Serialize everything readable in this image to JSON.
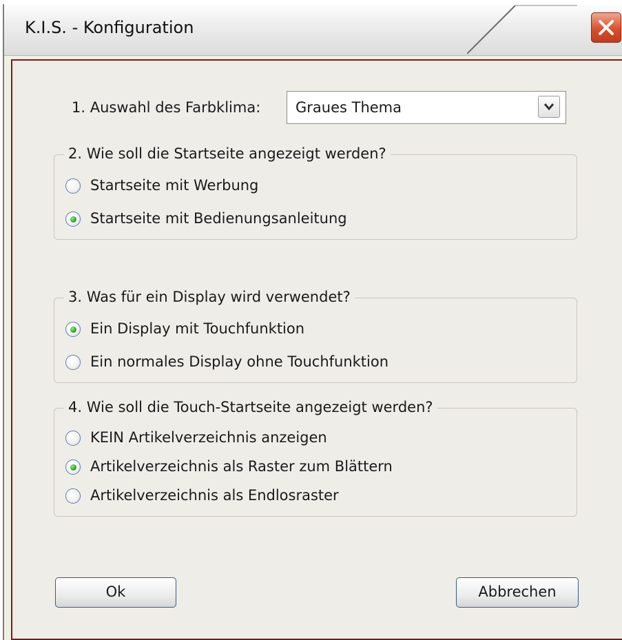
{
  "window": {
    "title": "K.I.S. - Konfiguration"
  },
  "theme": {
    "label": "1. Auswahl des Farbklima:",
    "selected": "Graues Thema"
  },
  "groups": [
    {
      "title": "2. Wie soll die Startseite angezeigt werden?",
      "options": [
        {
          "label": "Startseite mit Werbung",
          "checked": false
        },
        {
          "label": "Startseite mit Bedienungsanleitung",
          "checked": true
        }
      ]
    },
    {
      "title": "3. Was für ein Display wird verwendet?",
      "options": [
        {
          "label": "Ein Display mit Touchfunktion",
          "checked": true
        },
        {
          "label": "Ein normales Display ohne Touchfunktion",
          "checked": false
        }
      ]
    },
    {
      "title": "4. Wie soll die Touch-Startseite angezeigt werden?",
      "options": [
        {
          "label": "KEIN Artikelverzeichnis anzeigen",
          "checked": false
        },
        {
          "label": "Artikelverzeichnis als Raster zum Blättern",
          "checked": true
        },
        {
          "label": "Artikelverzeichnis als Endlosraster",
          "checked": false
        }
      ]
    }
  ],
  "buttons": {
    "ok": "Ok",
    "cancel": "Abbrechen"
  },
  "colors": {
    "frame": "#7a1a1a",
    "close": "#d8502c",
    "radio_dot": "#2aa52a"
  }
}
